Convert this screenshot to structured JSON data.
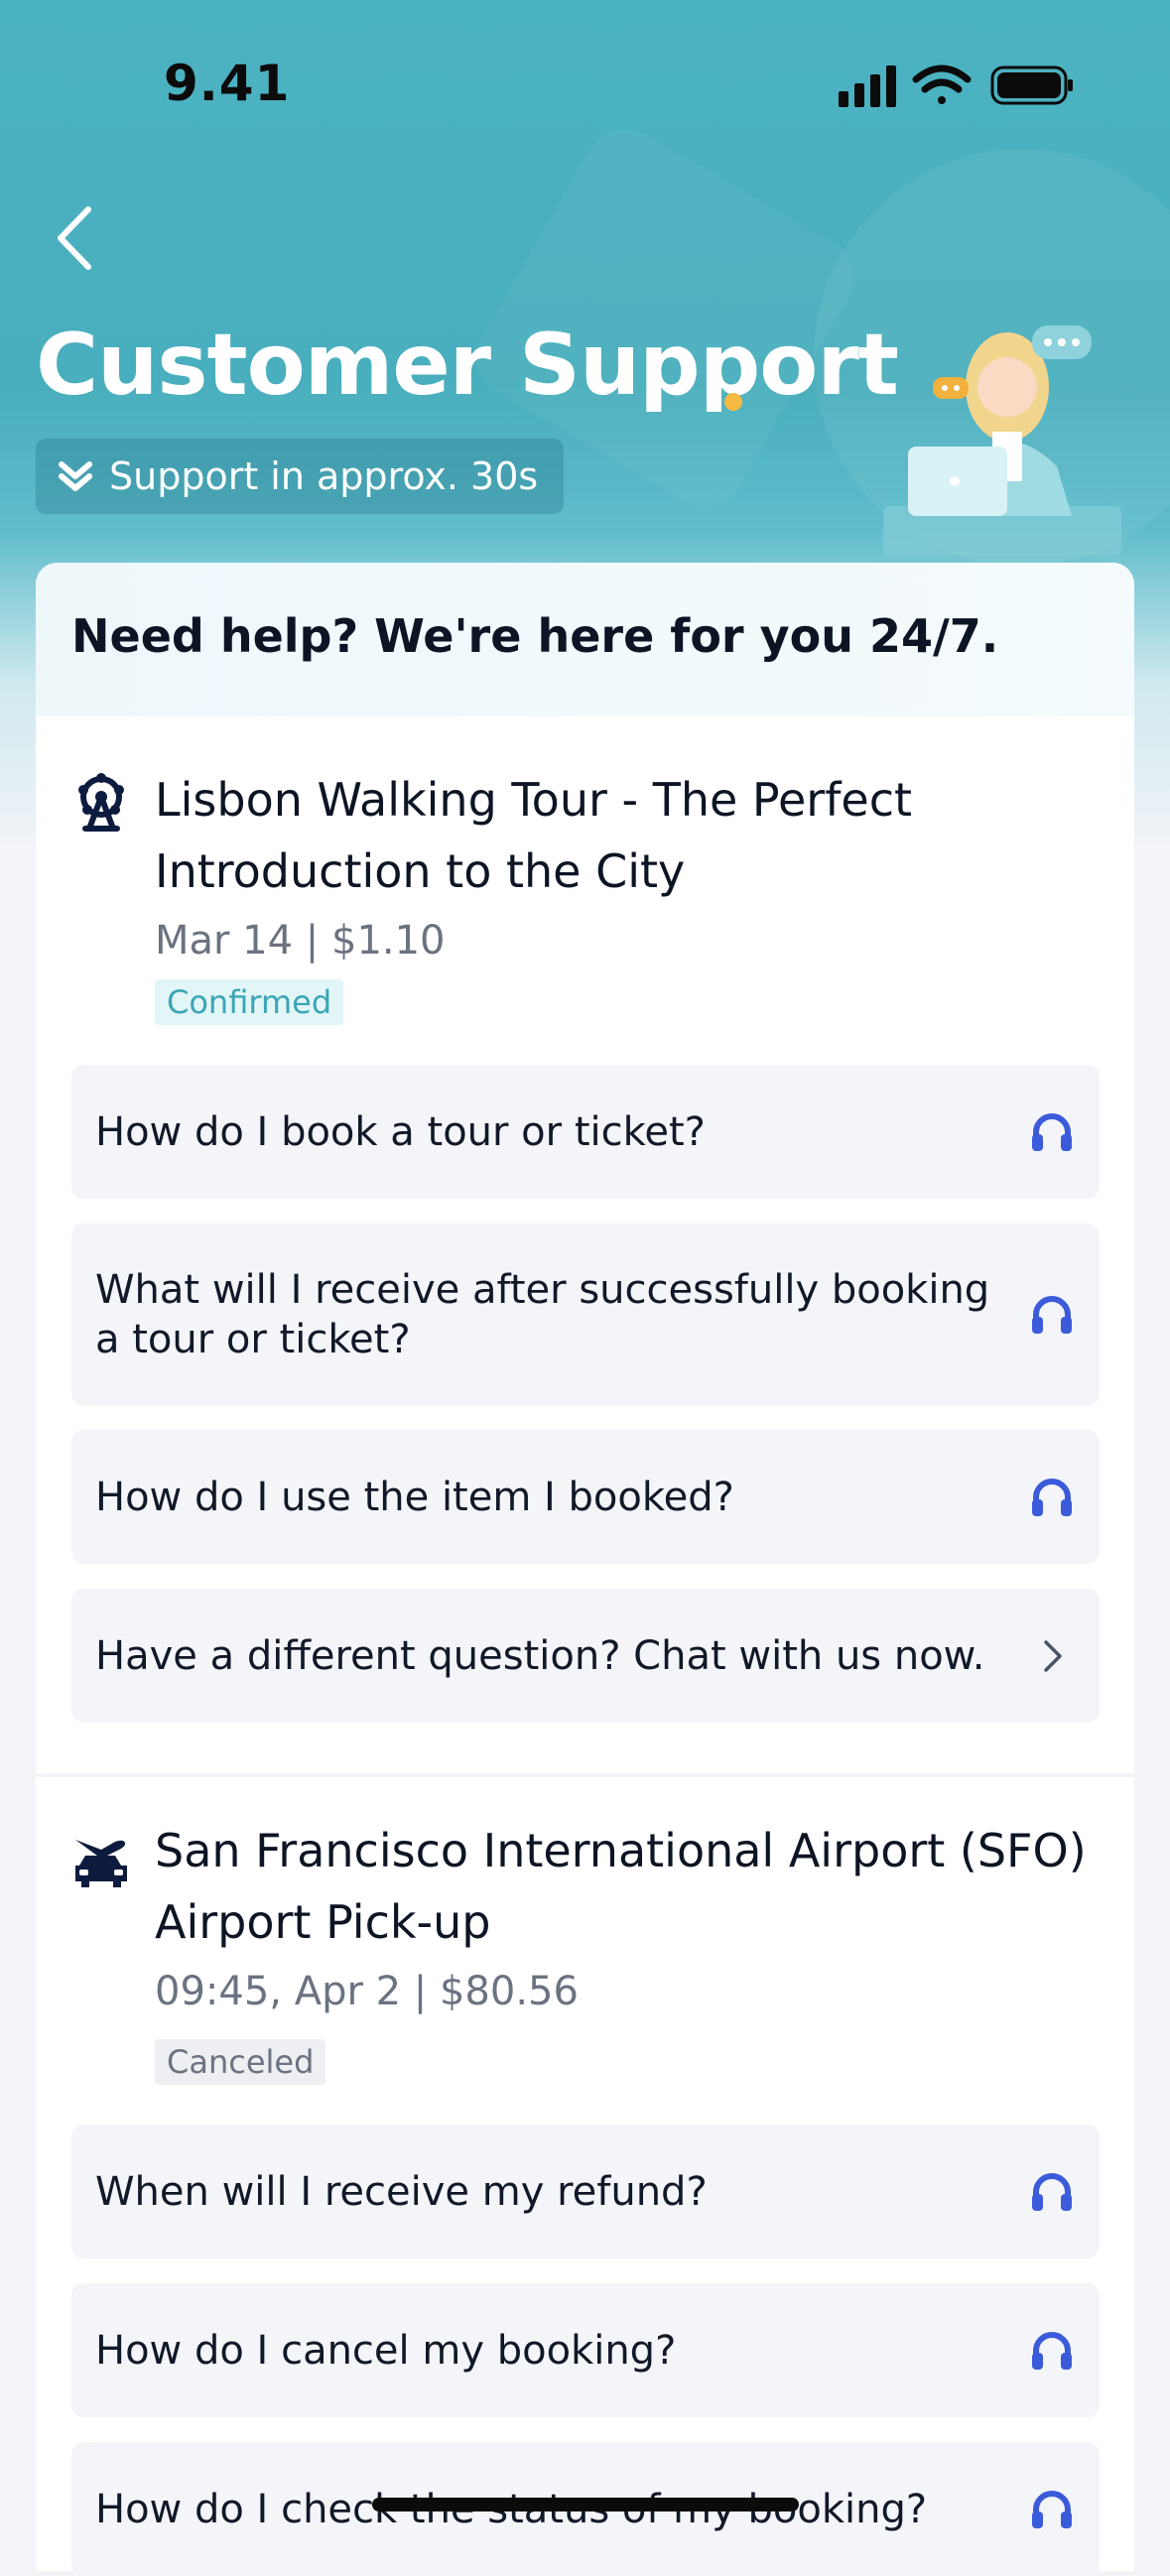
{
  "status_bar": {
    "time": "9.41"
  },
  "header": {
    "title": "Customer Support",
    "support_badge": "Support in approx. 30s"
  },
  "help_banner": "Need help? We're here for you 24/7.",
  "bookings": [
    {
      "icon": "ferris-wheel-icon",
      "title_line1": "Lisbon Walking Tour - The Perfect",
      "title_line2": "Introduction to the City",
      "meta": "Mar 14  | $1.10",
      "status": "Confirmed",
      "faqs": [
        {
          "question": "How do I book a tour or ticket?",
          "icon": "headset-icon"
        },
        {
          "question": "What will I receive after successfully booking a tour or ticket?",
          "icon": "headset-icon"
        },
        {
          "question": "How do I use the item I booked?",
          "icon": "headset-icon"
        },
        {
          "question": "Have a different question? Chat with us now.",
          "icon": "chevron-right-icon"
        }
      ]
    },
    {
      "icon": "airport-car-icon",
      "title_line1": "San Francisco International Airport (SFO)",
      "title_line2": "Airport Pick-up",
      "meta": "09:45, Apr 2  | $80.56",
      "status": "Canceled",
      "faqs": [
        {
          "question": "When will I receive my refund?",
          "icon": "headset-icon"
        },
        {
          "question": "How do I cancel my booking?",
          "icon": "headset-icon"
        },
        {
          "question": "How do I check the status of my booking?",
          "icon": "headset-icon"
        }
      ]
    }
  ],
  "colors": {
    "header": "#4cb3c2",
    "accent_icon": "#3b5bdb",
    "confirmed": "#3aa5b5",
    "title_dot": "#f5b942"
  }
}
